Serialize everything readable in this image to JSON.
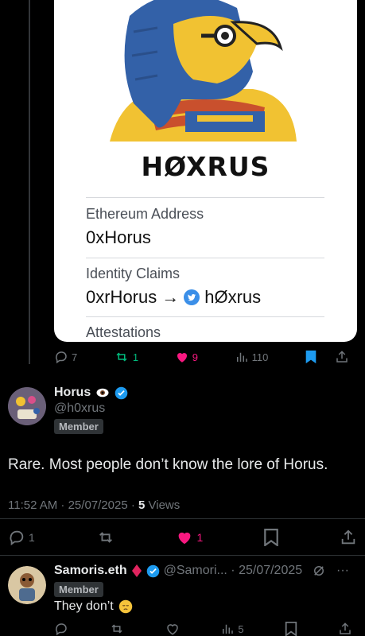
{
  "card": {
    "title": "HØXRUS",
    "eth_label": "Ethereum Address",
    "eth_value": "0xHorus",
    "claims_label": "Identity Claims",
    "claims_value_left": "0xrHorus",
    "claims_arrow": "→",
    "claims_value_right": "hØxrus",
    "attest_label": "Attestations"
  },
  "post_actions": {
    "replies": "7",
    "reposts": "1",
    "likes": "9",
    "views": "110"
  },
  "reply": {
    "name": "Horus",
    "handle": "@h0xrus",
    "badge": "Member",
    "text": "Rare. Most people don’t know the lore of Horus.",
    "time": "11:52 AM · 25/07/2025 · ",
    "views_count": "5",
    "views_label": " Views",
    "replies": "1",
    "likes": "1"
  },
  "reply2": {
    "name": "Samoris.eth",
    "handle_date": "@Samori... · 25/07/2025",
    "badge": "Member",
    "text": "They don’t",
    "views": "5"
  },
  "colors": {
    "accent": "#1d9bf0",
    "like": "#f91880",
    "repost": "#00ba7c"
  }
}
